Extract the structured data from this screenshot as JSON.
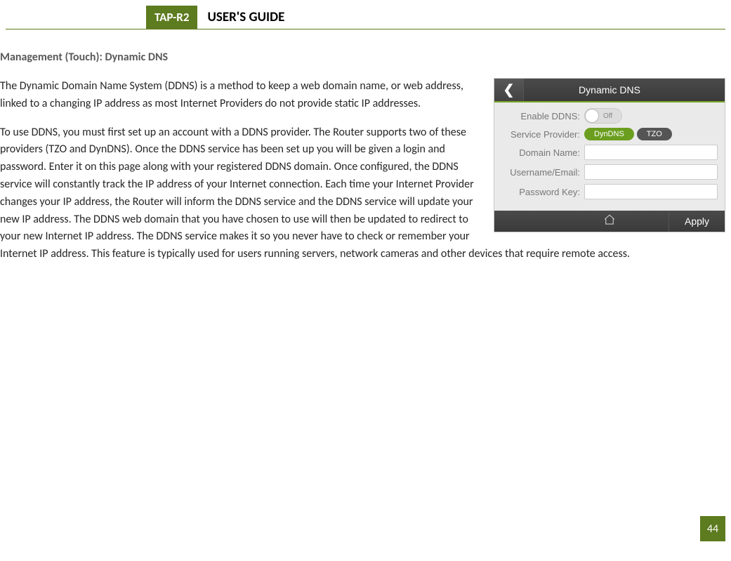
{
  "header": {
    "badge": "TAP-R2",
    "title": "USER'S GUIDE"
  },
  "section": {
    "title": "Management (Touch): Dynamic DNS"
  },
  "paragraphs": {
    "p1": "The Dynamic Domain Name System (DDNS) is a method to keep a web domain name, or web address, linked to a changing IP address as most Internet Providers do not provide static IP addresses.",
    "p2": "To use DDNS, you must first set up an account with a DDNS provider. The Router supports two of these providers (TZO and DynDNS). Once the DDNS service has been set up you will be given a login and password.  Enter it on this page along with your registered DDNS domain.  Once configured, the DDNS service will constantly track the IP address of your Internet connection. Each time your Internet Provider changes your IP address, the Router will inform the DDNS service and the DDNS service will update your new IP address.  The DDNS web domain that you have chosen to use will then be updated to redirect to your new Internet IP address.  The DDNS service makes it so you never have to check or remember your Internet IP address. This feature is typically used for users running servers, network cameras and other devices that require remote access."
  },
  "device": {
    "title": "Dynamic DNS",
    "labels": {
      "enable": "Enable DDNS:",
      "provider": "Service Provider:",
      "domain": "Domain Name:",
      "username": "Username/Email:",
      "password": "Password Key:"
    },
    "toggle_off": "Off",
    "providers": {
      "dyndns": "DynDNS",
      "tzo": "TZO"
    },
    "apply": "Apply"
  },
  "page_number": "44"
}
